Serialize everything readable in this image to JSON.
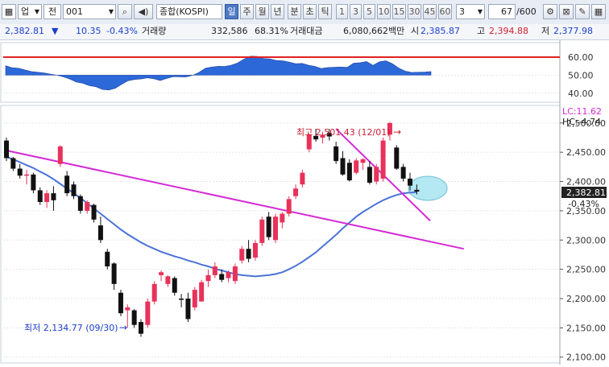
{
  "toolbar": {
    "market_select": "업",
    "prefix_box": "전",
    "code_input": "001",
    "search_icon": "search-icon",
    "speaker_icon": "speaker-icon",
    "name_input": "종합(KOSPI)",
    "periods": [
      "일",
      "주",
      "월",
      "년",
      "분",
      "초",
      "틱"
    ],
    "selected_period": "일",
    "intervals": [
      "1",
      "3",
      "5",
      "10",
      "15",
      "30",
      "45",
      "60"
    ],
    "custom_interval": "3",
    "count_value": "67",
    "count_total": "/600"
  },
  "info_bar": {
    "price": "2,382.81",
    "change_arrow": "▼",
    "change": "10.35",
    "change_pct": "-0.43%",
    "volume_label": "거래량",
    "volume": "332,586",
    "volume_ratio": "68.31%",
    "amount_label": "거래대금",
    "amount": "6,080,662백만",
    "open_label": "시",
    "open": "2,385.87",
    "high_label": "고",
    "high": "2,394.88",
    "low_label": "저",
    "low": "2,377.98"
  },
  "colors": {
    "up": "#e8325a",
    "down": "#111111",
    "ma_line": "#4a72d8",
    "trendline": "#d42ad4",
    "indicator_fill": "#2c68d8",
    "indicator_level": "#e02020",
    "highlight": "#a8e4f0"
  },
  "chart_data": [
    {
      "type": "area",
      "name": "indicator",
      "ylim": [
        35,
        68
      ],
      "y_ticks": [
        "60.00",
        "50.00",
        "40.00"
      ],
      "tick_values": [
        60,
        50,
        40
      ],
      "level_line": 60,
      "baseline": 50,
      "values": [
        55.2,
        54.1,
        53.8,
        52.9,
        52.0,
        51.6,
        51.2,
        50.5,
        50.0,
        49.0,
        47.8,
        46.2,
        45.5,
        44.2,
        43.6,
        42.1,
        41.8,
        42.7,
        44.9,
        46.9,
        47.6,
        47.9,
        48.5,
        48.0,
        47.0,
        48.2,
        49.2,
        49.1,
        49.0,
        49.9,
        51.5,
        53.8,
        54.5,
        54.9,
        54.8,
        55.5,
        56.7,
        58.9,
        60.5,
        60.4,
        59.2,
        59.0,
        58.1,
        57.9,
        57.2,
        56.3,
        56.5,
        55.5,
        54.8,
        53.7,
        54.2,
        54.4,
        54.5,
        54.3,
        56.6,
        56.9,
        57.5,
        55.4,
        57.4,
        57.9,
        56.3,
        53.9,
        52.2,
        51.5,
        51.6,
        51.7,
        52.0
      ]
    },
    {
      "type": "candlestick",
      "name": "KOSPI daily",
      "ylim": [
        2090,
        2530
      ],
      "y_ticks": [
        "2,500.00",
        "2,450.00",
        "2,400.00",
        "2,350.00",
        "2,300.00",
        "2,250.00",
        "2,200.00",
        "2,150.00",
        "2,100.00"
      ],
      "tick_values": [
        2500,
        2450,
        2400,
        2350,
        2300,
        2250,
        2200,
        2150,
        2100
      ],
      "candles": [
        {
          "o": 2470,
          "h": 2475,
          "l": 2435,
          "c": 2440
        },
        {
          "o": 2440,
          "h": 2442,
          "l": 2418,
          "c": 2422
        },
        {
          "o": 2422,
          "h": 2430,
          "l": 2405,
          "c": 2410
        },
        {
          "o": 2410,
          "h": 2420,
          "l": 2395,
          "c": 2412
        },
        {
          "o": 2412,
          "h": 2415,
          "l": 2380,
          "c": 2385
        },
        {
          "o": 2385,
          "h": 2390,
          "l": 2360,
          "c": 2365
        },
        {
          "o": 2365,
          "h": 2385,
          "l": 2355,
          "c": 2380
        },
        {
          "o": 2380,
          "h": 2392,
          "l": 2350,
          "c": 2368
        },
        {
          "o": 2430,
          "h": 2462,
          "l": 2425,
          "c": 2460
        },
        {
          "o": 2410,
          "h": 2418,
          "l": 2375,
          "c": 2380
        },
        {
          "o": 2395,
          "h": 2400,
          "l": 2370,
          "c": 2375
        },
        {
          "o": 2375,
          "h": 2378,
          "l": 2345,
          "c": 2350
        },
        {
          "o": 2350,
          "h": 2368,
          "l": 2345,
          "c": 2365
        },
        {
          "o": 2360,
          "h": 2362,
          "l": 2330,
          "c": 2335
        },
        {
          "o": 2325,
          "h": 2340,
          "l": 2295,
          "c": 2300
        },
        {
          "o": 2280,
          "h": 2285,
          "l": 2250,
          "c": 2255
        },
        {
          "o": 2260,
          "h": 2262,
          "l": 2215,
          "c": 2225
        },
        {
          "o": 2210,
          "h": 2215,
          "l": 2170,
          "c": 2175
        },
        {
          "o": 2180,
          "h": 2190,
          "l": 2150,
          "c": 2185
        },
        {
          "o": 2180,
          "h": 2182,
          "l": 2150,
          "c": 2155
        },
        {
          "o": 2160,
          "h": 2165,
          "l": 2134.77,
          "c": 2140
        },
        {
          "o": 2155,
          "h": 2200,
          "l": 2150,
          "c": 2195
        },
        {
          "o": 2195,
          "h": 2230,
          "l": 2190,
          "c": 2225
        },
        {
          "o": 2240,
          "h": 2248,
          "l": 2230,
          "c": 2245
        },
        {
          "o": 2225,
          "h": 2240,
          "l": 2220,
          "c": 2238
        },
        {
          "o": 2235,
          "h": 2238,
          "l": 2205,
          "c": 2210
        },
        {
          "o": 2200,
          "h": 2208,
          "l": 2185,
          "c": 2198
        },
        {
          "o": 2200,
          "h": 2210,
          "l": 2160,
          "c": 2165
        },
        {
          "o": 2185,
          "h": 2220,
          "l": 2180,
          "c": 2215
        },
        {
          "o": 2195,
          "h": 2232,
          "l": 2195,
          "c": 2228
        },
        {
          "o": 2230,
          "h": 2250,
          "l": 2220,
          "c": 2240
        },
        {
          "o": 2240,
          "h": 2262,
          "l": 2235,
          "c": 2255
        },
        {
          "o": 2242,
          "h": 2250,
          "l": 2228,
          "c": 2232
        },
        {
          "o": 2235,
          "h": 2248,
          "l": 2228,
          "c": 2245
        },
        {
          "o": 2230,
          "h": 2260,
          "l": 2225,
          "c": 2255
        },
        {
          "o": 2265,
          "h": 2290,
          "l": 2260,
          "c": 2285
        },
        {
          "o": 2285,
          "h": 2300,
          "l": 2262,
          "c": 2268
        },
        {
          "o": 2270,
          "h": 2300,
          "l": 2265,
          "c": 2295
        },
        {
          "o": 2295,
          "h": 2340,
          "l": 2290,
          "c": 2335
        },
        {
          "o": 2340,
          "h": 2348,
          "l": 2300,
          "c": 2305
        },
        {
          "o": 2300,
          "h": 2345,
          "l": 2295,
          "c": 2340
        },
        {
          "o": 2330,
          "h": 2348,
          "l": 2320,
          "c": 2345
        },
        {
          "o": 2345,
          "h": 2375,
          "l": 2340,
          "c": 2370
        },
        {
          "o": 2375,
          "h": 2395,
          "l": 2370,
          "c": 2388
        },
        {
          "o": 2395,
          "h": 2420,
          "l": 2390,
          "c": 2415
        },
        {
          "o": 2455,
          "h": 2482,
          "l": 2450,
          "c": 2480
        },
        {
          "o": 2478,
          "h": 2490,
          "l": 2468,
          "c": 2472
        },
        {
          "o": 2475,
          "h": 2485,
          "l": 2465,
          "c": 2480
        },
        {
          "o": 2483,
          "h": 2490,
          "l": 2470,
          "c": 2477
        },
        {
          "o": 2460,
          "h": 2468,
          "l": 2430,
          "c": 2435
        },
        {
          "o": 2440,
          "h": 2452,
          "l": 2410,
          "c": 2412
        },
        {
          "o": 2432,
          "h": 2438,
          "l": 2400,
          "c": 2402
        },
        {
          "o": 2415,
          "h": 2440,
          "l": 2412,
          "c": 2436
        },
        {
          "o": 2432,
          "h": 2440,
          "l": 2420,
          "c": 2438
        },
        {
          "o": 2425,
          "h": 2435,
          "l": 2395,
          "c": 2398
        },
        {
          "o": 2400,
          "h": 2430,
          "l": 2395,
          "c": 2425
        },
        {
          "o": 2405,
          "h": 2475,
          "l": 2400,
          "c": 2470
        },
        {
          "o": 2480,
          "h": 2501.43,
          "l": 2470,
          "c": 2500
        },
        {
          "o": 2458,
          "h": 2462,
          "l": 2420,
          "c": 2422
        },
        {
          "o": 2425,
          "h": 2430,
          "l": 2400,
          "c": 2405
        },
        {
          "o": 2405,
          "h": 2415,
          "l": 2385,
          "c": 2393
        },
        {
          "o": 2385.87,
          "h": 2394.88,
          "l": 2377.98,
          "c": 2382.81
        }
      ],
      "moving_average": [
        2442,
        2438,
        2433,
        2428,
        2423,
        2417,
        2411,
        2404,
        2396,
        2388,
        2380,
        2372,
        2363,
        2354,
        2345,
        2336,
        2327,
        2318,
        2310,
        2303,
        2296,
        2290,
        2285,
        2280,
        2276,
        2272,
        2269,
        2265,
        2262,
        2258,
        2255,
        2251,
        2248,
        2245,
        2242,
        2240,
        2239,
        2238,
        2239,
        2240,
        2242,
        2245,
        2250,
        2256,
        2263,
        2271,
        2279,
        2289,
        2299,
        2309,
        2320,
        2330,
        2340,
        2348,
        2355,
        2362,
        2368,
        2373,
        2377,
        2380,
        2381,
        2382
      ],
      "trendlines": [
        {
          "from_index": 0,
          "from_value": 2453,
          "to_index": 68,
          "to_value": 2285
        },
        {
          "from_index": 49,
          "from_value": 2490,
          "to_index": 63,
          "to_value": 2333
        }
      ],
      "annotations": {
        "high_label": "최고 2,501.43 (12/01)",
        "high_arrow": "→",
        "low_label": "최저 2,134.77 (09/30)",
        "low_arrow": "→",
        "lc_label": "LC:11.62",
        "hc_label": "HC:-4.74",
        "last_price": "2,382.81",
        "last_change_pct": "-0.43%"
      }
    }
  ]
}
